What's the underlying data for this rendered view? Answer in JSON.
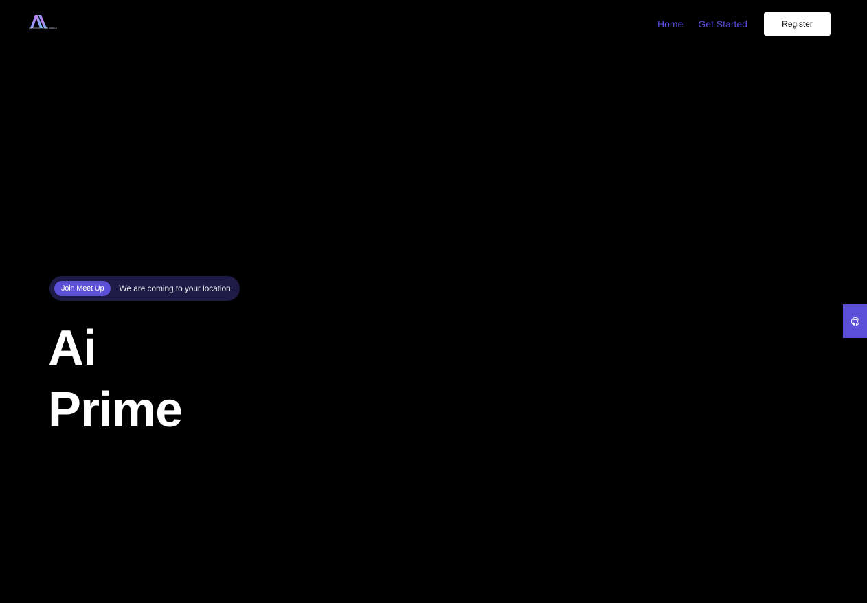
{
  "header": {
    "logo_text": "ARTIFICIAL INTELLIGENCE",
    "nav": [
      {
        "label": "Home"
      },
      {
        "label": "Get Started"
      }
    ],
    "register_label": "Register"
  },
  "hero": {
    "badge": "Join Meet Up",
    "announcement": "We are coming to your location.",
    "title_line1": "Ai",
    "title_line2": "Prime"
  },
  "side_tab": {
    "icon": "github-icon"
  },
  "colors": {
    "background": "#000000",
    "accent": "#5a4fd6",
    "nav_link": "#5b50e0",
    "pill_bg": "#1e1c46"
  }
}
